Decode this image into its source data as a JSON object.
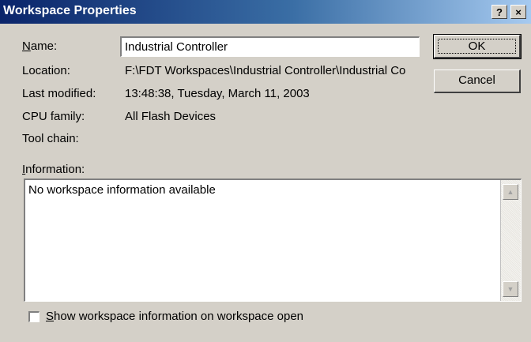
{
  "window": {
    "title": "Workspace Properties",
    "help_glyph": "?",
    "close_glyph": "×"
  },
  "fields": {
    "name": {
      "label_key": "N",
      "label_rest": "ame:",
      "value": "Industrial Controller"
    },
    "location": {
      "label": "Location:",
      "value": "F:\\FDT Workspaces\\Industrial Controller\\Industrial Co"
    },
    "last_modified": {
      "label": "Last modified:",
      "value": "13:48:38, Tuesday, March 11, 2003"
    },
    "cpu_family": {
      "label": "CPU family:",
      "value": "All Flash Devices"
    },
    "tool_chain": {
      "label": "Tool chain:",
      "value": ""
    }
  },
  "buttons": {
    "ok": "OK",
    "cancel": "Cancel"
  },
  "information": {
    "label_key": "I",
    "label_rest": "nformation:",
    "text": "No workspace information available"
  },
  "scrollbar": {
    "up_glyph": "▲",
    "down_glyph": "▼"
  },
  "checkbox": {
    "label_key": "S",
    "label_rest": "how workspace information on workspace open",
    "checked": false
  }
}
